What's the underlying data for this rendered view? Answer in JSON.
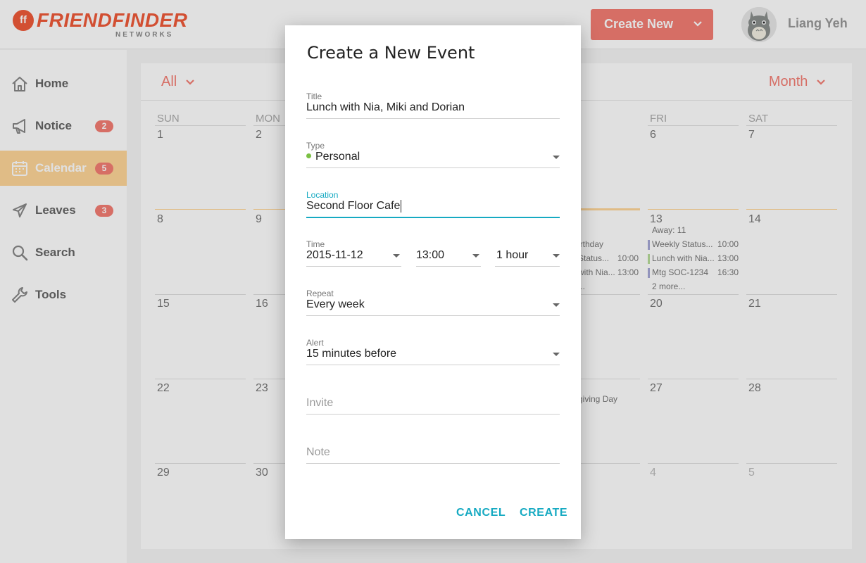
{
  "header": {
    "logo_mark": "ff",
    "logo_name": "FRIENDFINDER",
    "logo_sub": "NETWORKS",
    "create_new_label": "Create New",
    "user_name": "Liang Yeh"
  },
  "sidebar": {
    "items": [
      {
        "label": "Home",
        "icon": "home-icon"
      },
      {
        "label": "Notice",
        "icon": "megaphone-icon",
        "badge": "2"
      },
      {
        "label": "Calendar",
        "icon": "calendar-icon",
        "badge": "5",
        "active": true
      },
      {
        "label": "Leaves",
        "icon": "airplane-icon",
        "badge": "3"
      },
      {
        "label": "Search",
        "icon": "search-icon"
      },
      {
        "label": "Tools",
        "icon": "wrench-icon"
      }
    ]
  },
  "calendar": {
    "filter": "All",
    "view": "Month",
    "weekdays": [
      "SUN",
      "MON",
      "",
      "",
      "",
      "FRI",
      "SAT"
    ],
    "weeks": [
      [
        "1",
        "2",
        "",
        "",
        "",
        "6",
        "7"
      ],
      [
        "8",
        "9",
        "",
        "",
        "",
        "13",
        "14"
      ],
      [
        "15",
        "16",
        "",
        "",
        "",
        "20",
        "21"
      ],
      [
        "22",
        "23",
        "",
        "",
        "",
        "27",
        "28"
      ],
      [
        "29",
        "30",
        "",
        "",
        "",
        "4",
        "5"
      ]
    ],
    "thu_events": {
      "birthday": "irthday",
      "e1": "Status...",
      "e1_time": "10:00",
      "e2": "with Nia...",
      "e2_time": "13:00",
      "more": "...",
      "holiday": "giving Day"
    },
    "fri_events": {
      "away": "Away: 11",
      "e1": "Weekly Status...",
      "e1_time": "10:00",
      "e2": "Lunch with Nia...",
      "e2_time": "13:00",
      "e3": "Mtg SOC-1234",
      "e3_time": "16:30",
      "more": "2 more..."
    },
    "colors": {
      "accent": "#f47e74",
      "active_nav": "#ffd699",
      "today_line": "#ffd699"
    }
  },
  "dialog": {
    "title": "Create a New Event",
    "title_field": {
      "label": "Title",
      "value": "Lunch with Nia, Miki and Dorian"
    },
    "type_field": {
      "label": "Type",
      "value": "Personal",
      "dot_color": "#7bc043"
    },
    "location_field": {
      "label": "Location",
      "value": "Second Floor Cafe"
    },
    "time_field": {
      "label": "Time",
      "date": "2015-11-12",
      "start": "13:00",
      "duration": "1 hour"
    },
    "repeat_field": {
      "label": "Repeat",
      "value": "Every week"
    },
    "alert_field": {
      "label": "Alert",
      "value": "15 minutes before"
    },
    "invite_placeholder": "Invite",
    "note_placeholder": "Note",
    "cancel_label": "CANCEL",
    "create_label": "CREATE",
    "accent_color": "#16aac2"
  }
}
